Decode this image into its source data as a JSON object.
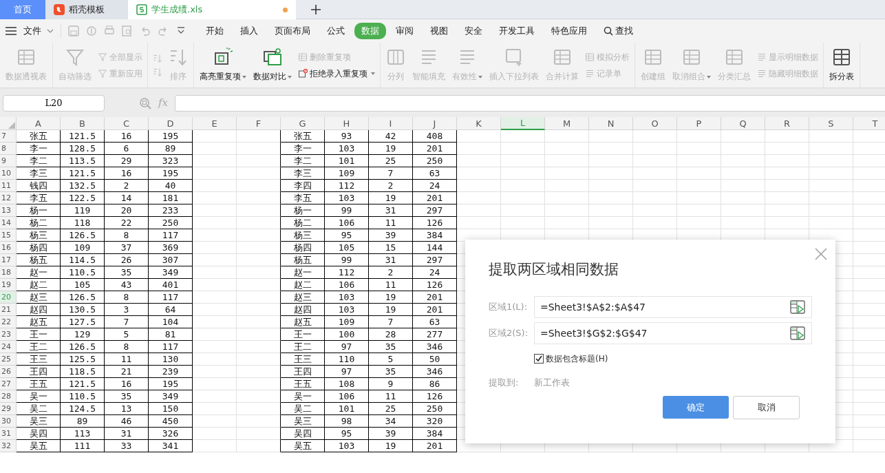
{
  "tabs": [
    {
      "label": "首页",
      "kind": "home",
      "selected": false
    },
    {
      "label": "稻壳模板",
      "kind": "template",
      "selected": false
    },
    {
      "label": "学生成绩.xls",
      "kind": "sheet",
      "selected": true,
      "modified": true
    }
  ],
  "menu": {
    "file_label": "文件",
    "tabs": [
      {
        "label": "开始",
        "selected": false
      },
      {
        "label": "插入",
        "selected": false
      },
      {
        "label": "页面布局",
        "selected": false
      },
      {
        "label": "公式",
        "selected": false
      },
      {
        "label": "数据",
        "selected": true
      },
      {
        "label": "审阅",
        "selected": false
      },
      {
        "label": "视图",
        "selected": false
      },
      {
        "label": "安全",
        "selected": false
      },
      {
        "label": "开发工具",
        "selected": false
      },
      {
        "label": "特色应用",
        "selected": false
      }
    ],
    "search_label": "查找"
  },
  "ribbon": {
    "groups": [
      {
        "items": [
          {
            "kind": "large",
            "label": "数据透视表",
            "disabled": true,
            "dropdown": false
          }
        ]
      },
      {
        "items": [
          {
            "kind": "large",
            "label": "自动筛选",
            "disabled": true,
            "dropdown": false
          },
          {
            "kind": "stack",
            "items": [
              {
                "label": "全部显示",
                "disabled": true
              },
              {
                "label": "重新应用",
                "disabled": true
              }
            ]
          }
        ]
      },
      {
        "items": [
          {
            "kind": "stack",
            "items": [
              {
                "disabled": true
              },
              {
                "disabled": true
              }
            ]
          },
          {
            "kind": "large",
            "label": "排序",
            "disabled": true,
            "dropdown": false
          }
        ]
      },
      {
        "items": [
          {
            "kind": "large",
            "label": "高亮重复项",
            "disabled": false,
            "dropdown": true
          },
          {
            "kind": "large",
            "label": "数据对比",
            "disabled": false,
            "dropdown": true
          },
          {
            "kind": "stack",
            "items": [
              {
                "label": "删除重复项",
                "disabled": true
              },
              {
                "label": "拒绝录入重复项",
                "disabled": false,
                "dropdown": true
              }
            ]
          }
        ]
      },
      {
        "items": [
          {
            "kind": "large",
            "label": "分列",
            "disabled": true,
            "dropdown": false
          },
          {
            "kind": "large",
            "label": "智能填充",
            "disabled": true,
            "dropdown": false
          },
          {
            "kind": "large",
            "label": "有效性",
            "disabled": true,
            "dropdown": true
          },
          {
            "kind": "large",
            "label": "插入下拉列表",
            "disabled": true,
            "dropdown": false
          },
          {
            "kind": "large",
            "label": "合并计算",
            "disabled": true,
            "dropdown": false
          },
          {
            "kind": "stack",
            "items": [
              {
                "label": "模拟分析",
                "disabled": true
              },
              {
                "label": "记录单",
                "disabled": true
              }
            ]
          }
        ]
      },
      {
        "items": [
          {
            "kind": "large",
            "label": "创建组",
            "disabled": true,
            "dropdown": false
          },
          {
            "kind": "large",
            "label": "取消组合",
            "disabled": true,
            "dropdown": true
          },
          {
            "kind": "large",
            "label": "分类汇总",
            "disabled": true,
            "dropdown": false
          },
          {
            "kind": "stack",
            "items": [
              {
                "label": "显示明细数据",
                "disabled": true
              },
              {
                "label": "隐藏明细数据",
                "disabled": true
              }
            ]
          }
        ]
      },
      {
        "items": [
          {
            "kind": "large",
            "label": "拆分表",
            "disabled": false,
            "dropdown": false
          }
        ]
      }
    ]
  },
  "formula_bar": {
    "name_box": "L20",
    "fx_label": "fx"
  },
  "sheet": {
    "columns": [
      {
        "label": "A",
        "selected": false
      },
      {
        "label": "B",
        "selected": false
      },
      {
        "label": "C",
        "selected": false
      },
      {
        "label": "D",
        "selected": false
      },
      {
        "label": "E",
        "selected": false
      },
      {
        "label": "F",
        "selected": false
      },
      {
        "label": "G",
        "selected": false
      },
      {
        "label": "H",
        "selected": false
      },
      {
        "label": "I",
        "selected": false
      },
      {
        "label": "J",
        "selected": false
      },
      {
        "label": "K",
        "selected": false
      },
      {
        "label": "L",
        "selected": true
      },
      {
        "label": "M",
        "selected": false
      },
      {
        "label": "N",
        "selected": false
      },
      {
        "label": "O",
        "selected": false
      },
      {
        "label": "P",
        "selected": false
      },
      {
        "label": "Q",
        "selected": false
      },
      {
        "label": "R",
        "selected": false
      },
      {
        "label": "S",
        "selected": false
      },
      {
        "label": "T",
        "selected": false
      }
    ],
    "rows": [
      {
        "number": "7",
        "selected": false,
        "cells": [
          "张五",
          "121.5",
          "16",
          "195",
          "",
          "",
          "张五",
          "93",
          "42",
          "408"
        ]
      },
      {
        "number": "8",
        "selected": false,
        "cells": [
          "李一",
          "128.5",
          "6",
          "89",
          "",
          "",
          "李一",
          "103",
          "19",
          "201"
        ]
      },
      {
        "number": "9",
        "selected": false,
        "cells": [
          "李二",
          "113.5",
          "29",
          "323",
          "",
          "",
          "李二",
          "101",
          "25",
          "250"
        ]
      },
      {
        "number": "10",
        "selected": false,
        "cells": [
          "李三",
          "121.5",
          "16",
          "195",
          "",
          "",
          "李三",
          "109",
          "7",
          "63"
        ]
      },
      {
        "number": "11",
        "selected": false,
        "cells": [
          "钱四",
          "132.5",
          "2",
          "40",
          "",
          "",
          "李四",
          "112",
          "2",
          "24"
        ]
      },
      {
        "number": "12",
        "selected": false,
        "cells": [
          "李五",
          "122.5",
          "14",
          "181",
          "",
          "",
          "李五",
          "103",
          "19",
          "201"
        ]
      },
      {
        "number": "13",
        "selected": false,
        "cells": [
          "杨一",
          "119",
          "20",
          "233",
          "",
          "",
          "杨一",
          "99",
          "31",
          "297"
        ]
      },
      {
        "number": "14",
        "selected": false,
        "cells": [
          "杨二",
          "118",
          "22",
          "250",
          "",
          "",
          "杨二",
          "106",
          "11",
          "126"
        ]
      },
      {
        "number": "15",
        "selected": false,
        "cells": [
          "杨三",
          "126.5",
          "8",
          "117",
          "",
          "",
          "杨三",
          "95",
          "39",
          "384"
        ]
      },
      {
        "number": "16",
        "selected": false,
        "cells": [
          "杨四",
          "109",
          "37",
          "369",
          "",
          "",
          "杨四",
          "105",
          "15",
          "144"
        ]
      },
      {
        "number": "17",
        "selected": false,
        "cells": [
          "杨五",
          "114.5",
          "26",
          "307",
          "",
          "",
          "杨五",
          "99",
          "31",
          "297"
        ]
      },
      {
        "number": "18",
        "selected": false,
        "cells": [
          "赵一",
          "110.5",
          "35",
          "349",
          "",
          "",
          "赵一",
          "112",
          "2",
          "24"
        ]
      },
      {
        "number": "19",
        "selected": false,
        "cells": [
          "赵二",
          "105",
          "43",
          "401",
          "",
          "",
          "赵二",
          "106",
          "11",
          "126"
        ]
      },
      {
        "number": "20",
        "selected": true,
        "cells": [
          "赵三",
          "126.5",
          "8",
          "117",
          "",
          "",
          "赵三",
          "103",
          "19",
          "201"
        ]
      },
      {
        "number": "21",
        "selected": false,
        "cells": [
          "赵四",
          "130.5",
          "3",
          "64",
          "",
          "",
          "赵四",
          "103",
          "19",
          "201"
        ]
      },
      {
        "number": "22",
        "selected": false,
        "cells": [
          "赵五",
          "127.5",
          "7",
          "104",
          "",
          "",
          "赵五",
          "109",
          "7",
          "63"
        ]
      },
      {
        "number": "23",
        "selected": false,
        "cells": [
          "王一",
          "129",
          "5",
          "81",
          "",
          "",
          "王一",
          "100",
          "28",
          "277"
        ]
      },
      {
        "number": "24",
        "selected": false,
        "cells": [
          "王二",
          "126.5",
          "8",
          "117",
          "",
          "",
          "王二",
          "97",
          "35",
          "346"
        ]
      },
      {
        "number": "25",
        "selected": false,
        "cells": [
          "王三",
          "125.5",
          "11",
          "130",
          "",
          "",
          "王三",
          "110",
          "5",
          "50"
        ]
      },
      {
        "number": "26",
        "selected": false,
        "cells": [
          "王四",
          "118.5",
          "21",
          "239",
          "",
          "",
          "王四",
          "97",
          "35",
          "346"
        ]
      },
      {
        "number": "27",
        "selected": false,
        "cells": [
          "王五",
          "121.5",
          "16",
          "195",
          "",
          "",
          "王五",
          "108",
          "9",
          "86"
        ]
      },
      {
        "number": "28",
        "selected": false,
        "cells": [
          "吴一",
          "110.5",
          "35",
          "349",
          "",
          "",
          "吴一",
          "106",
          "11",
          "126"
        ]
      },
      {
        "number": "29",
        "selected": false,
        "cells": [
          "吴二",
          "124.5",
          "13",
          "150",
          "",
          "",
          "吴二",
          "101",
          "25",
          "250"
        ]
      },
      {
        "number": "30",
        "selected": false,
        "cells": [
          "吴三",
          "89",
          "46",
          "450",
          "",
          "",
          "吴三",
          "98",
          "34",
          "320"
        ]
      },
      {
        "number": "31",
        "selected": false,
        "cells": [
          "吴四",
          "113",
          "31",
          "326",
          "",
          "",
          "吴四",
          "95",
          "39",
          "384"
        ]
      },
      {
        "number": "32",
        "selected": false,
        "cells": [
          "吴五",
          "111",
          "33",
          "341",
          "",
          "",
          "吴五",
          "103",
          "19",
          "201"
        ]
      }
    ]
  },
  "dialog": {
    "title": "提取两区域相同数据",
    "fields": [
      {
        "label": "区域1(L):",
        "value": "=Sheet3!$A$2:$A$47"
      },
      {
        "label": "区域2(S):",
        "value": "=Sheet3!$G$2:$G$47"
      }
    ],
    "checkbox": {
      "label": "数据包含标题(H)",
      "checked": true
    },
    "target": {
      "label": "提取到:",
      "value": "新工作表"
    },
    "buttons": [
      {
        "label": "确定",
        "kind": "primary"
      },
      {
        "label": "取消",
        "kind": "secondary"
      }
    ]
  }
}
